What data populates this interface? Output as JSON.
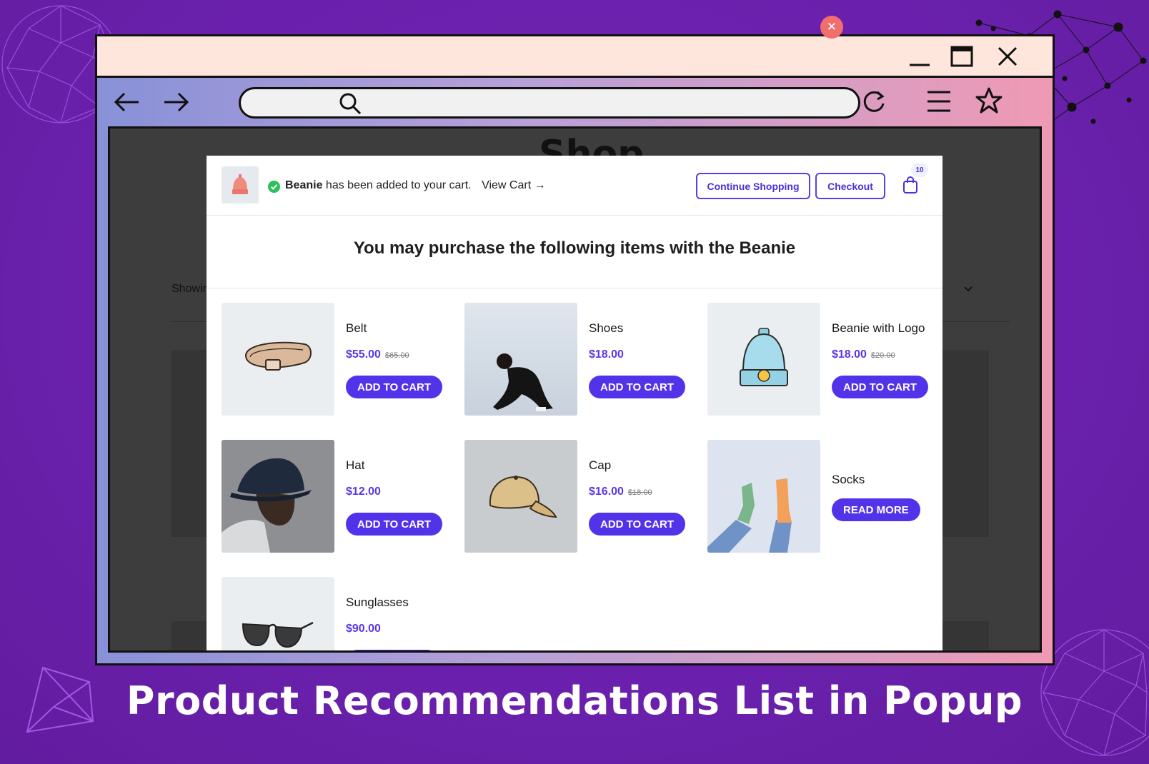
{
  "caption": "Product Recommendations List in Popup",
  "colors": {
    "background": "#6b21a8",
    "accent": "#5233ea",
    "close": "#f26d6d",
    "success": "#2fbf5c"
  },
  "browser": {
    "window_controls": [
      "minimize-icon",
      "maximize-icon",
      "close-icon"
    ],
    "toolbar_icons": [
      "back-arrow-icon",
      "forward-arrow-icon",
      "search-icon",
      "reload-icon",
      "menu-icon",
      "star-icon"
    ],
    "url_value": ""
  },
  "shop_page": {
    "title": "Shop",
    "showing_text": "Showing"
  },
  "popup": {
    "notice": {
      "product_name": "Beanie",
      "message": "has been added to your cart.",
      "view_cart": "View Cart →"
    },
    "continue_label": "Continue Shopping",
    "checkout_label": "Checkout",
    "cart_count": "10",
    "heading": "You may purchase the following items with the Beanie",
    "products": [
      {
        "name": "Belt",
        "price": "$55.00",
        "old_price": "$65.00",
        "cta": "ADD TO CART",
        "image": "belt"
      },
      {
        "name": "Shoes",
        "price": "$18.00",
        "old_price": "",
        "cta": "ADD TO CART",
        "image": "woman-photo"
      },
      {
        "name": "Beanie with Logo",
        "price": "$18.00",
        "old_price": "$20.00",
        "cta": "ADD TO CART",
        "image": "beanie"
      },
      {
        "name": "Hat",
        "price": "$12.00",
        "old_price": "",
        "cta": "ADD TO CART",
        "image": "man-in-hat-photo"
      },
      {
        "name": "Cap",
        "price": "$16.00",
        "old_price": "$18.00",
        "cta": "ADD TO CART",
        "image": "cap"
      },
      {
        "name": "Socks",
        "price": "",
        "old_price": "",
        "cta": "READ MORE",
        "image": "socks-photo"
      },
      {
        "name": "Sunglasses",
        "price": "$90.00",
        "old_price": "",
        "cta": "",
        "image": "sunglasses"
      }
    ]
  }
}
